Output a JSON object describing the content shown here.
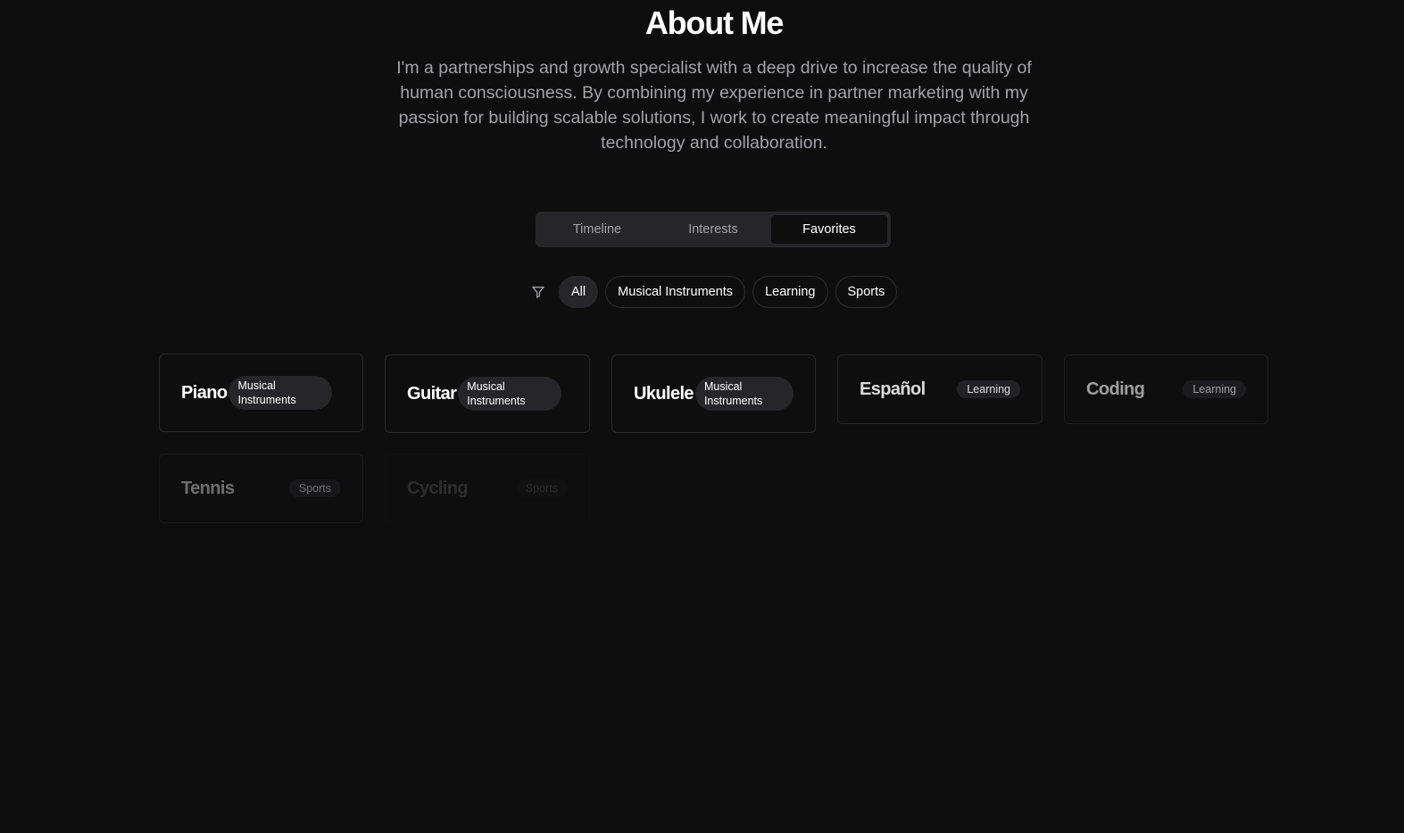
{
  "header": {
    "title": "About Me",
    "intro": "I'm a partnerships and growth specialist with a deep drive to increase the quality of human consciousness. By combining my experience in partner marketing with my passion for building scalable solutions, I work to create meaningful impact through technology and collaboration."
  },
  "tabs": [
    {
      "label": "Timeline",
      "active": false
    },
    {
      "label": "Interests",
      "active": false
    },
    {
      "label": "Favorites",
      "active": true
    }
  ],
  "filters": {
    "icon": "filter-icon",
    "chips": [
      {
        "label": "All",
        "active": true
      },
      {
        "label": "Musical Instruments",
        "active": false
      },
      {
        "label": "Learning",
        "active": false
      },
      {
        "label": "Sports",
        "active": false
      }
    ]
  },
  "favorites": [
    {
      "title": "Piano",
      "category": "Musical Instruments",
      "opacity": 1.0
    },
    {
      "title": "Guitar",
      "category": "Musical Instruments",
      "opacity": 1.0
    },
    {
      "title": "Ukulele",
      "category": "Musical Instruments",
      "opacity": 1.0
    },
    {
      "title": "Español",
      "category": "Learning",
      "opacity": 0.85
    },
    {
      "title": "Coding",
      "category": "Learning",
      "opacity": 0.6
    },
    {
      "title": "Tennis",
      "category": "Sports",
      "opacity": 0.4
    },
    {
      "title": "Cycling",
      "category": "Sports",
      "opacity": 0.12
    }
  ],
  "colors": {
    "background": "#0e0e0e",
    "surface": "#26262a",
    "border": "#2a2a2e",
    "muted_text": "#a3a3a8",
    "text": "#ffffff"
  }
}
